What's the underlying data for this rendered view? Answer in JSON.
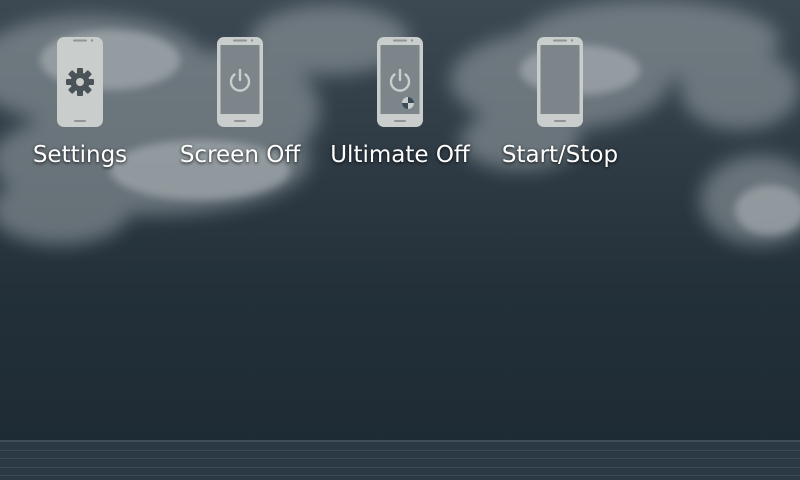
{
  "colors": {
    "sky_top": "#3a4650",
    "sky_bottom": "#1e2b35",
    "sea": "#2a3844",
    "cloud": "#b8bfc2",
    "icon_fill": "#c9cdcb",
    "label": "#ffffff"
  },
  "shortcuts": [
    {
      "label": "Settings",
      "icon": "phone-settings-icon"
    },
    {
      "label": "Screen Off",
      "icon": "phone-power-icon"
    },
    {
      "label": "Ultimate Off",
      "icon": "phone-power-ultimate-icon"
    },
    {
      "label": "Start/Stop",
      "icon": "phone-blank-icon"
    }
  ]
}
